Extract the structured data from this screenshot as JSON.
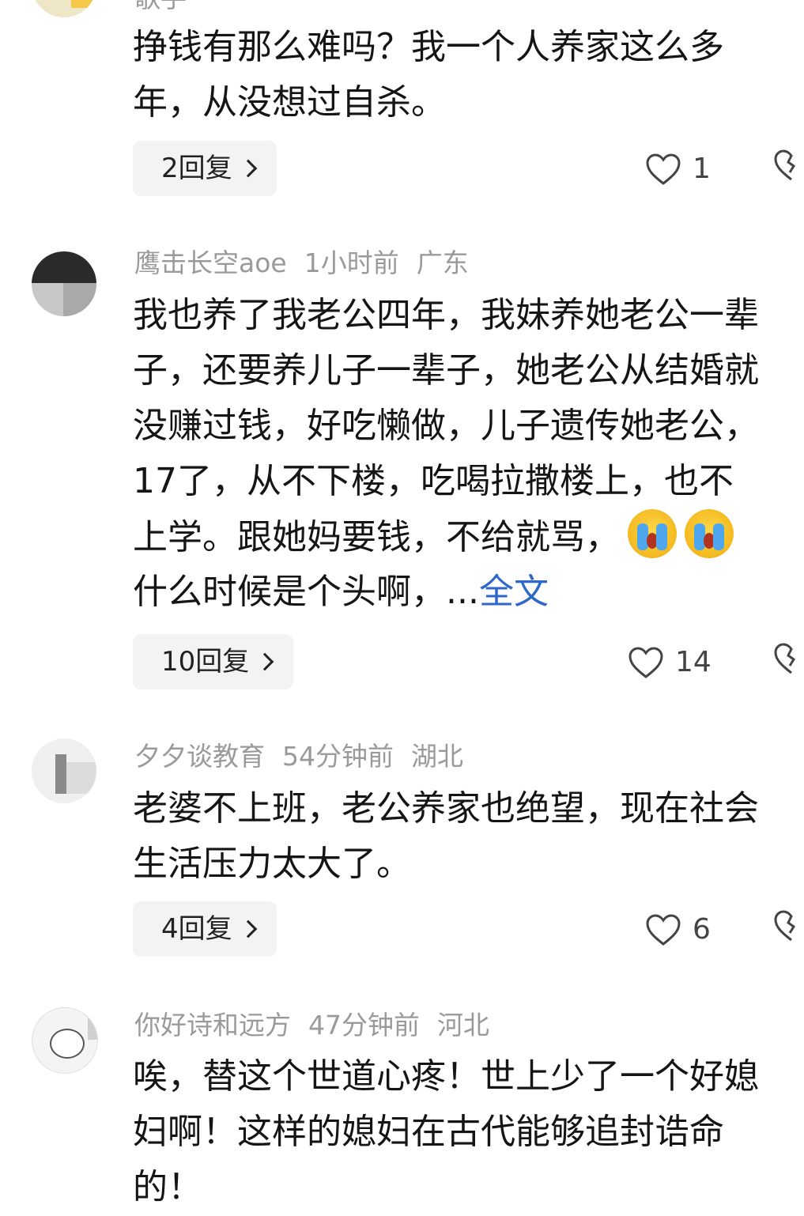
{
  "comments": [
    {
      "username": "歌手",
      "time": "",
      "location": "",
      "lines": [
        "挣钱有那么难吗？我一个人养家这么多",
        "年，从没想过自杀。"
      ],
      "reply_label": "2回复",
      "likes": "1"
    },
    {
      "username": "鹰击长空aoe",
      "time": "1小时前",
      "location": "广东",
      "lines": [
        "我也养了我老公四年，我妹养她老公一辈",
        "子，还要养儿子一辈子，她老公从结婚就",
        "没赚过钱，好吃懒做，儿子遗传她老公，",
        "17了，从不下楼，吃喝拉撒楼上，也不",
        "上学。跟她妈要钱，不给就骂，",
        "什么时候是个头啊，..."
      ],
      "emoji": "crying-face-emoji",
      "full_text_link": "全文",
      "reply_label": "10回复",
      "likes": "14"
    },
    {
      "username": "夕夕谈教育",
      "time": "54分钟前",
      "location": "湖北",
      "lines": [
        "老婆不上班，老公养家也绝望，现在社会",
        "生活压力太大了。"
      ],
      "reply_label": "4回复",
      "likes": "6"
    },
    {
      "username": "你好诗和远方",
      "time": "47分钟前",
      "location": "河北",
      "lines": [
        "唉，替这个世道心疼！世上少了一个好媳",
        "妇啊！这样的媳妇在古代能够追封诰命",
        "的！"
      ]
    }
  ],
  "icons": {
    "like": "heart-outline-icon",
    "dislike": "broken-heart-icon",
    "reply_arrow": "chevron-right-icon"
  },
  "colors": {
    "meta_text": "#9a9a9a",
    "body_text": "#151515",
    "link": "#2e67c9",
    "reply_bg": "#f3f3f3"
  }
}
